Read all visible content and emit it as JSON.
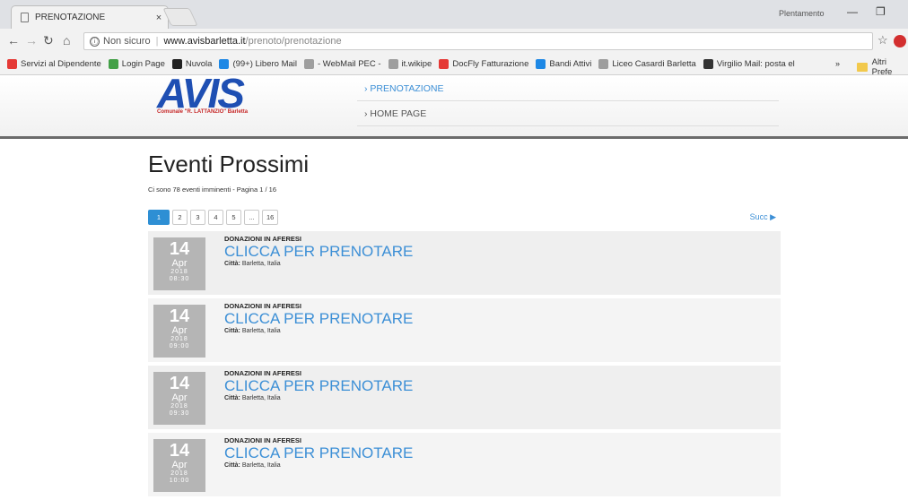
{
  "browser": {
    "tab_title": "PRENOTAZIONE",
    "tab_close": "×",
    "user_label": "Plentamento",
    "address_info": "ⓘ",
    "security_label": "Non sicuro",
    "url_host": "www.avisbarletta.it",
    "url_path": "/prenoto/prenotazione",
    "bookmarks": [
      {
        "label": "Servizi al Dipendente",
        "color": "#e53935"
      },
      {
        "label": "Login Page",
        "color": "#43a047"
      },
      {
        "label": "Nuvola",
        "color": "#222222"
      },
      {
        "label": "(99+) Libero Mail",
        "color": "#1e88e5"
      },
      {
        "label": "- WebMail PEC -",
        "color": "#9e9e9e"
      },
      {
        "label": "it.wikipe",
        "color": "#9e9e9e"
      },
      {
        "label": "DocFly Fatturazione",
        "color": "#e53935"
      },
      {
        "label": "Bandi Attivi",
        "color": "#1e88e5"
      },
      {
        "label": "Liceo Casardi Barletta",
        "color": "#9e9e9e"
      },
      {
        "label": "Virgilio Mail: posta el",
        "color": "#333333"
      }
    ],
    "bookmarks_more": "»",
    "other_bookmarks": "Altri Prefe"
  },
  "site": {
    "logo_text": "AVIS",
    "logo_subtitle": "Comunale \"R. LATTANZIO\" Barletta",
    "menu": [
      {
        "label": "› PRENOTAZIONE",
        "active": true
      },
      {
        "label": "› HOME PAGE",
        "active": false
      }
    ]
  },
  "main": {
    "title": "Eventi Prossimi",
    "summary": "Ci sono 78 eventi imminenti - Pagina 1 / 16",
    "pagination": [
      "1",
      "2",
      "3",
      "4",
      "5",
      "...",
      "16"
    ],
    "current_page": "1",
    "next_label": "Succ ▶",
    "events": [
      {
        "day": "14",
        "month": "Apr",
        "year": "2018",
        "time": "08:30",
        "category": "DONAZIONI IN AFERESI",
        "title": "CLICCA PER PRENOTARE",
        "city_label": "Città:",
        "city": "Barletta, Italia"
      },
      {
        "day": "14",
        "month": "Apr",
        "year": "2018",
        "time": "09:00",
        "category": "DONAZIONI IN AFERESI",
        "title": "CLICCA PER PRENOTARE",
        "city_label": "Città:",
        "city": "Barletta, Italia"
      },
      {
        "day": "14",
        "month": "Apr",
        "year": "2018",
        "time": "09:30",
        "category": "DONAZIONI IN AFERESI",
        "title": "CLICCA PER PRENOTARE",
        "city_label": "Città:",
        "city": "Barletta, Italia"
      },
      {
        "day": "14",
        "month": "Apr",
        "year": "2018",
        "time": "10:00",
        "category": "DONAZIONI IN AFERESI",
        "title": "CLICCA PER PRENOTARE",
        "city_label": "Città:",
        "city": "Barletta, Italia"
      }
    ]
  }
}
